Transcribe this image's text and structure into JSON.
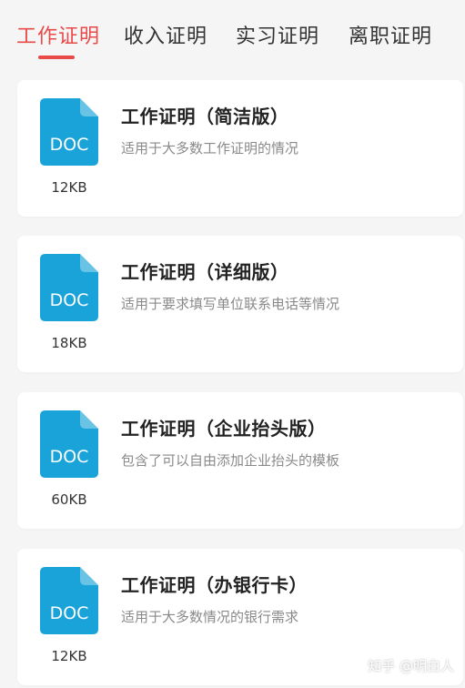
{
  "tabs": [
    {
      "label": "工作证明",
      "active": true
    },
    {
      "label": "收入证明",
      "active": false
    },
    {
      "label": "实习证明",
      "active": false
    },
    {
      "label": "离职证明",
      "active": false
    }
  ],
  "accent_color": "#e84a4a",
  "doc_icon_color": "#1aa3d8",
  "doc_icon_text": "DOC",
  "templates": [
    {
      "title": "工作证明（简洁版）",
      "description": "适用于大多数工作证明的情况",
      "size": "12KB"
    },
    {
      "title": "工作证明（详细版）",
      "description": "适用于要求填写单位联系电话等情况",
      "size": "18KB"
    },
    {
      "title": "工作证明（企业抬头版）",
      "description": "包含了可以自由添加企业抬头的模板",
      "size": "60KB"
    },
    {
      "title": "工作证明（办银行卡）",
      "description": "适用于大多数情况的银行需求",
      "size": "12KB"
    }
  ],
  "watermark": "知乎 @明白人"
}
